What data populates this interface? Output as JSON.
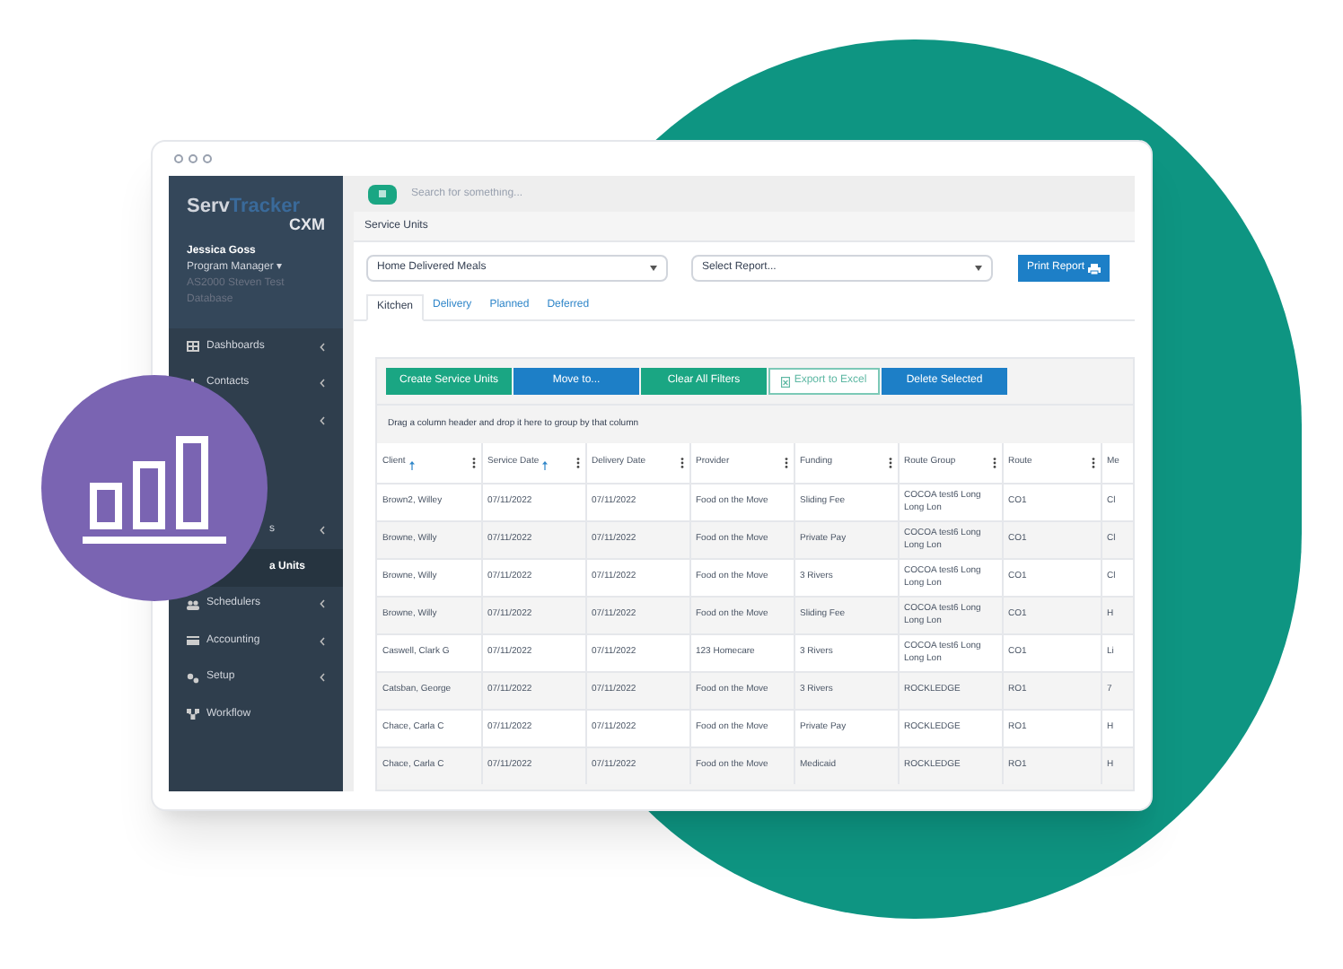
{
  "brand": {
    "name_a": "Serv",
    "name_b": "Tracker",
    "sub": "CXM"
  },
  "user": {
    "name": "Jessica Goss",
    "role": "Program Manager ▾",
    "database": "AS2000 Steven Test Database"
  },
  "sidebar": {
    "items": [
      {
        "label": "Dashboards",
        "kind": "grid",
        "chevron": true,
        "selected": false,
        "partial": false
      },
      {
        "label": "Contacts",
        "kind": "bars",
        "chevron": true,
        "selected": false,
        "partial": false
      },
      {
        "chevron": true,
        "selected": false
      },
      {
        "chevron": false,
        "selected": false
      },
      {
        "chevron": false,
        "selected": false
      },
      {
        "label": "s",
        "chevron": true,
        "selected": false,
        "partial": true
      },
      {
        "label": "a Units",
        "chevron": false,
        "selected": true,
        "partial": true
      },
      {
        "label": "Schedulers",
        "kind": "people",
        "chevron": true,
        "selected": false,
        "partial": false
      },
      {
        "label": "Accounting",
        "kind": "card",
        "chevron": true,
        "selected": false,
        "partial": false
      },
      {
        "label": "Setup",
        "kind": "gears",
        "chevron": true,
        "selected": false,
        "partial": false
      },
      {
        "label": "Workflow",
        "kind": "flow",
        "chevron": false,
        "selected": false,
        "partial": false
      }
    ]
  },
  "search": {
    "placeholder": "Search for something..."
  },
  "panel_title": "Service Units",
  "program_select": {
    "value": "Home Delivered Meals"
  },
  "report_select": {
    "value": "Select Report..."
  },
  "print_button": "Print Report",
  "tabs": [
    {
      "label": "Kitchen",
      "selected": true
    },
    {
      "label": "Delivery",
      "selected": false
    },
    {
      "label": "Planned",
      "selected": false
    },
    {
      "label": "Deferred",
      "selected": false
    }
  ],
  "actions": [
    {
      "label": "Create Service Units",
      "kind": "teal"
    },
    {
      "label": "Move to...",
      "kind": "blue"
    },
    {
      "label": "Clear All Filters",
      "kind": "teal"
    },
    {
      "label": "Export to Excel",
      "kind": "outline"
    },
    {
      "label": "Delete Selected",
      "kind": "blue"
    }
  ],
  "group_hint": "Drag a column header and drop it here to group by that column",
  "table": {
    "columns": [
      {
        "label": "Client",
        "sorted": true
      },
      {
        "label": "Service Date",
        "sorted": true
      },
      {
        "label": "Delivery Date",
        "sorted": false
      },
      {
        "label": "Provider",
        "sorted": false
      },
      {
        "label": "Funding",
        "sorted": false
      },
      {
        "label": "Route Group",
        "sorted": false
      },
      {
        "label": "Route",
        "sorted": false
      },
      {
        "label": "Me"
      }
    ],
    "rows": [
      [
        "Brown2, Willey",
        "07/11/2022",
        "07/11/2022",
        "Food on the Move",
        "Sliding Fee",
        "COCOA test6 Long Long Lon",
        "CO1",
        "Cl"
      ],
      [
        "Browne, Willy",
        "07/11/2022",
        "07/11/2022",
        "Food on the Move",
        "Private Pay",
        "COCOA test6 Long Long Lon",
        "CO1",
        "Cl"
      ],
      [
        "Browne, Willy",
        "07/11/2022",
        "07/11/2022",
        "Food on the Move",
        "3 Rivers",
        "COCOA test6 Long Long Lon",
        "CO1",
        "Cl"
      ],
      [
        "Browne, Willy",
        "07/11/2022",
        "07/11/2022",
        "Food on the Move",
        "Sliding Fee",
        "COCOA test6 Long Long Lon",
        "CO1",
        "H"
      ],
      [
        "Caswell, Clark G",
        "07/11/2022",
        "07/11/2022",
        "123 Homecare",
        "3 Rivers",
        "COCOA test6 Long Long Lon",
        "CO1",
        "Li"
      ],
      [
        "Catsban, George",
        "07/11/2022",
        "07/11/2022",
        "Food on the Move",
        "3 Rivers",
        "ROCKLEDGE",
        "RO1",
        "7"
      ],
      [
        "Chace, Carla C",
        "07/11/2022",
        "07/11/2022",
        "Food on the Move",
        "Private Pay",
        "ROCKLEDGE",
        "RO1",
        "H"
      ],
      [
        "Chace, Carla C",
        "07/11/2022",
        "07/11/2022",
        "Food on the Move",
        "Medicaid",
        "ROCKLEDGE",
        "RO1",
        "H"
      ]
    ]
  }
}
